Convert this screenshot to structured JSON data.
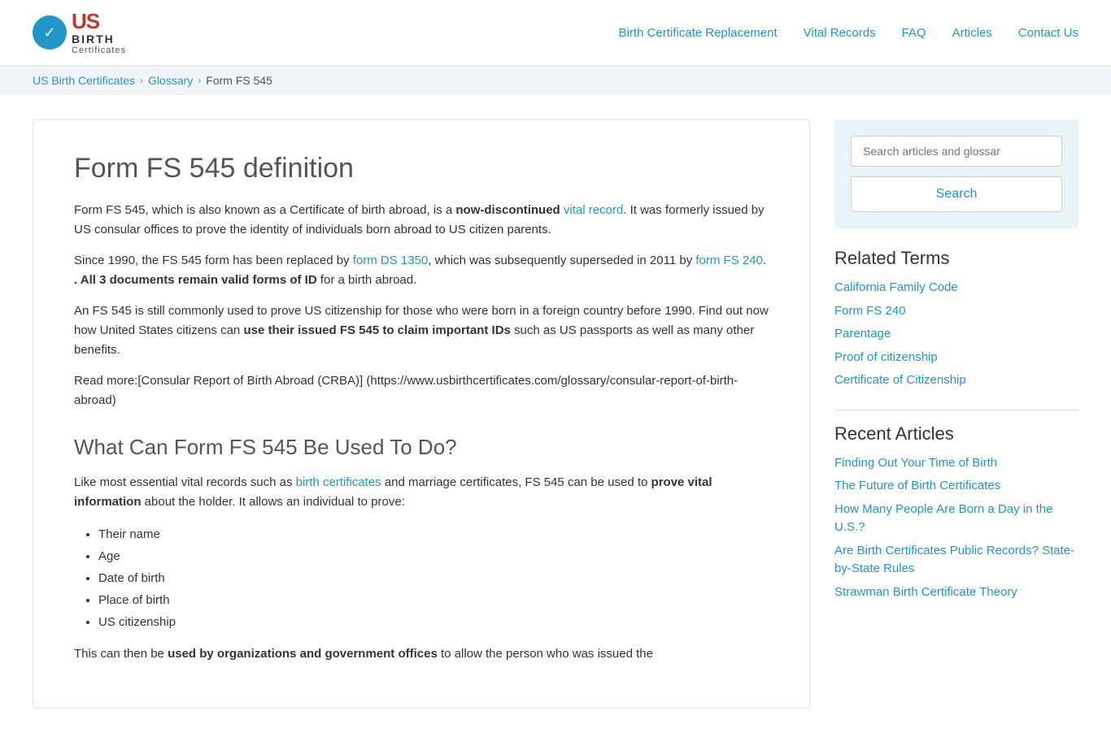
{
  "header": {
    "logo_check": "✓",
    "logo_us": "US",
    "logo_birth": "BIRTH",
    "logo_certificates": "Certificates",
    "nav": [
      {
        "label": "Birth Certificate Replacement",
        "href": "#"
      },
      {
        "label": "Vital Records",
        "href": "#"
      },
      {
        "label": "FAQ",
        "href": "#"
      },
      {
        "label": "Articles",
        "href": "#"
      },
      {
        "label": "Contact Us",
        "href": "#"
      }
    ]
  },
  "breadcrumb": {
    "items": [
      {
        "label": "US Birth Certificates",
        "href": "#"
      },
      {
        "label": "Glossary",
        "href": "#"
      },
      {
        "label": "Form FS 545",
        "href": null
      }
    ]
  },
  "content": {
    "title": "Form FS 545 definition",
    "para1_pre": "Form FS 545, which is also known as a Certificate of birth abroad, is a ",
    "para1_bold": "now-discontinued",
    "para1_link_text": "vital record",
    "para1_post": ". It was formerly issued by US consular offices to prove the identity of individuals born abroad to US citizen parents.",
    "para2_pre": "Since 1990, the FS 545 form has been replaced by ",
    "para2_link1": "form DS 1350",
    "para2_mid": ", which was subsequently superseded in 2011 by ",
    "para2_link2": "form FS 240",
    "para2_bold": ". All 3 documents remain valid forms of ID",
    "para2_post": " for a birth abroad.",
    "para3_pre": "An FS 545 is still commonly used to prove US citizenship for those who were born in a foreign country before 1990. Find out now how United States citizens can ",
    "para3_bold": "use their issued FS 545 to claim important IDs",
    "para3_post": " such as US passports as well as many other benefits.",
    "para4": "Read more:[Consular Report of Birth Abroad (CRBA)] (https://www.usbirthcertificates.com/glossary/consular-report-of-birth-abroad)",
    "h2": "What Can Form FS 545 Be Used To Do?",
    "para5_pre": "Like most essential vital records such as ",
    "para5_link": "birth certificates",
    "para5_post": " and marriage certificates, FS 545 can be used to ",
    "para5_bold": "prove vital information",
    "para5_post2": " about the holder. It allows an individual to prove:",
    "list_items": [
      "Their name",
      "Age",
      "Date of birth",
      "Place of birth",
      "US citizenship"
    ],
    "para6_pre": "This can then be ",
    "para6_bold": "used by organizations and government offices",
    "para6_post": " to allow the person who was issued the"
  },
  "sidebar": {
    "search": {
      "placeholder": "Search articles and glossar",
      "button_label": "Search"
    },
    "related_terms": {
      "heading": "Related Terms",
      "items": [
        {
          "label": "California Family Code",
          "href": "#"
        },
        {
          "label": "Form FS 240",
          "href": "#"
        },
        {
          "label": "Parentage",
          "href": "#"
        },
        {
          "label": "Proof of citizenship",
          "href": "#"
        },
        {
          "label": "Certificate of Citizenship",
          "href": "#"
        }
      ]
    },
    "recent_articles": {
      "heading": "Recent Articles",
      "items": [
        {
          "label": "Finding Out Your Time of Birth",
          "href": "#"
        },
        {
          "label": "The Future of Birth Certificates",
          "href": "#"
        },
        {
          "label": "How Many People Are Born a Day in the U.S.?",
          "href": "#"
        },
        {
          "label": "Are Birth Certificates Public Records? State-by-State Rules",
          "href": "#"
        },
        {
          "label": "Strawman Birth Certificate Theory",
          "href": "#"
        }
      ]
    }
  }
}
